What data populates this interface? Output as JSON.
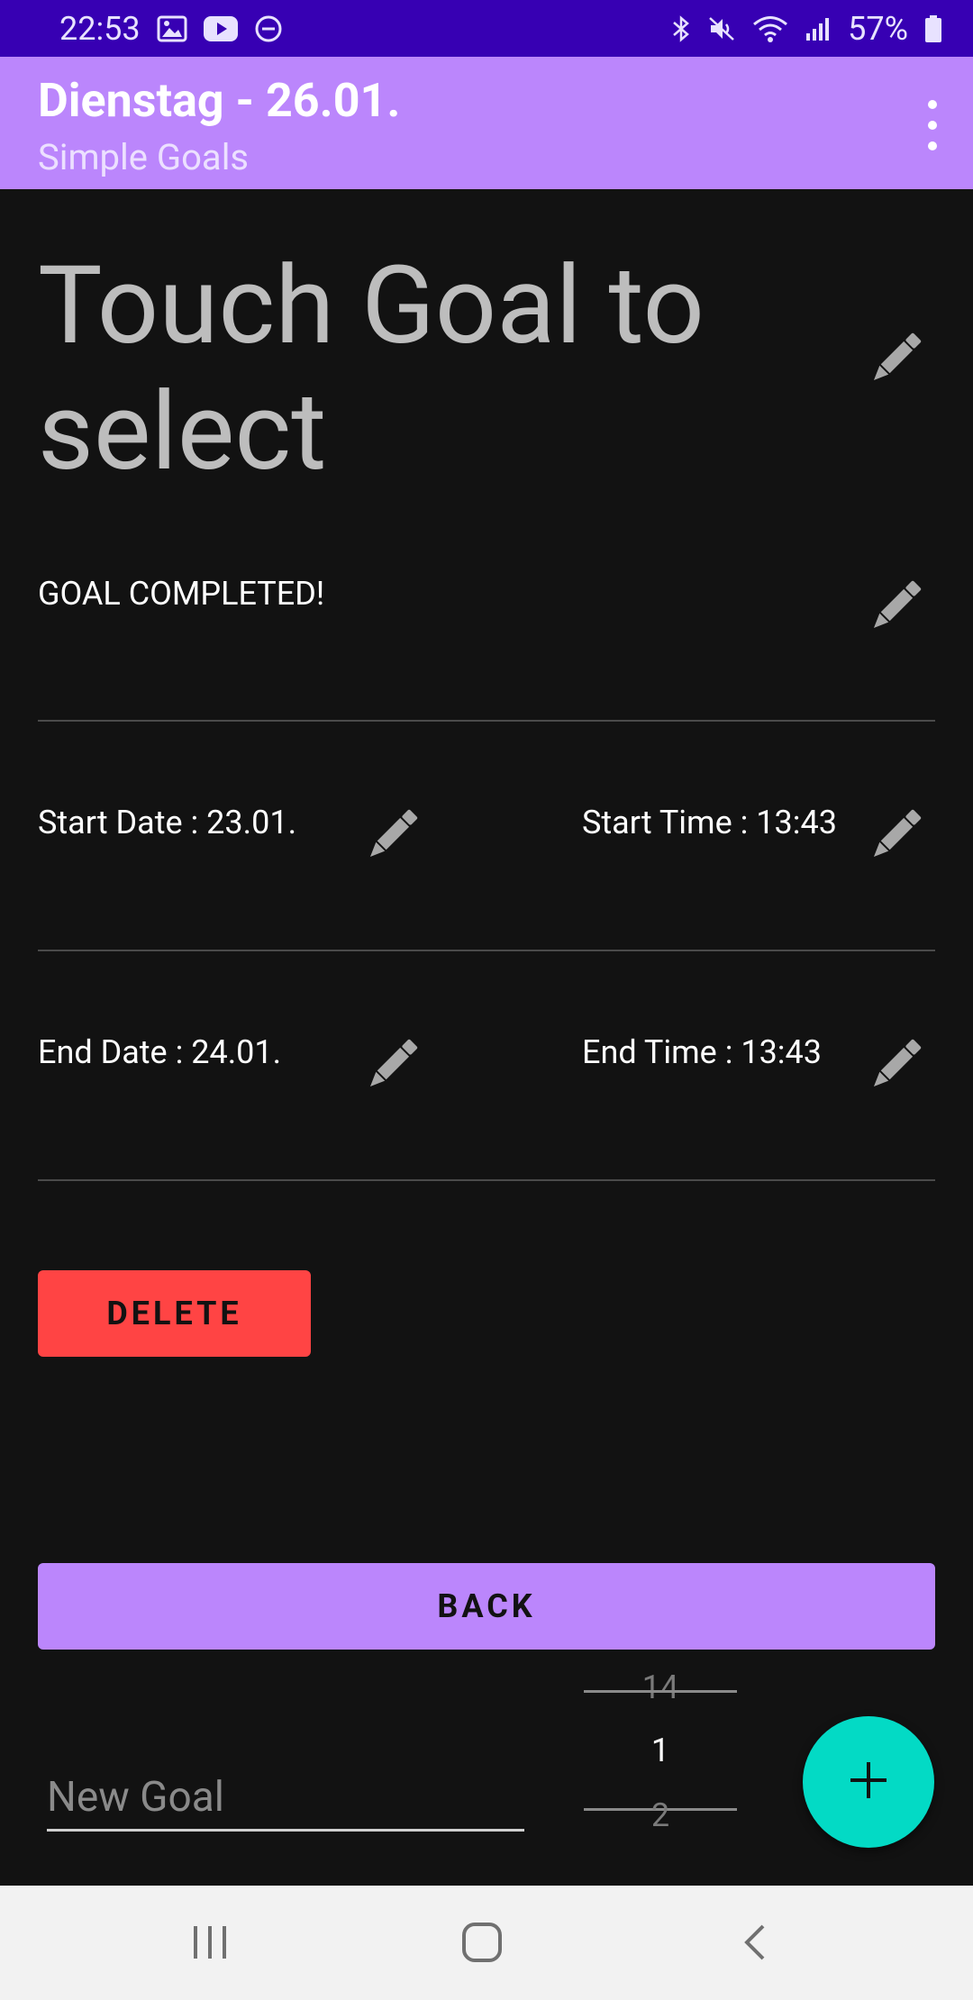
{
  "status_bar": {
    "time": "22:53",
    "battery": "57%",
    "left_icons": [
      "image-icon",
      "youtube-icon",
      "do-not-disturb-icon"
    ],
    "right_icons": [
      "bluetooth-icon",
      "mute-icon",
      "wifi-icon",
      "signal-icon",
      "battery-icon"
    ]
  },
  "app_bar": {
    "title": "Dienstag - 26.01.",
    "subtitle": "Simple Goals",
    "menu_icon": "more-vert-icon"
  },
  "goal": {
    "title": "Touch Goal to select",
    "status": "GOAL COMPLETED!",
    "start_date_label": "Start Date  : 23.01.",
    "start_time_label": "Start Time : 13:43",
    "end_date_label": "End Date  : 24.01.",
    "end_time_label": "End Time : 13:43",
    "edit_icon": "pencil-icon"
  },
  "buttons": {
    "delete": "DELETE",
    "back": "BACK"
  },
  "new_goal": {
    "placeholder": "New Goal",
    "value": ""
  },
  "number_picker": {
    "prev": "14",
    "current": "1",
    "next": "2"
  },
  "fab_icon": "plus-icon",
  "colors": {
    "status_bar": "#3700b3",
    "app_bar": "#bb86fc",
    "background": "#121212",
    "delete": "#ff4444",
    "fab": "#03dac5"
  },
  "nav_bar": {
    "icons": [
      "recent-apps-icon",
      "home-icon",
      "back-icon"
    ]
  }
}
